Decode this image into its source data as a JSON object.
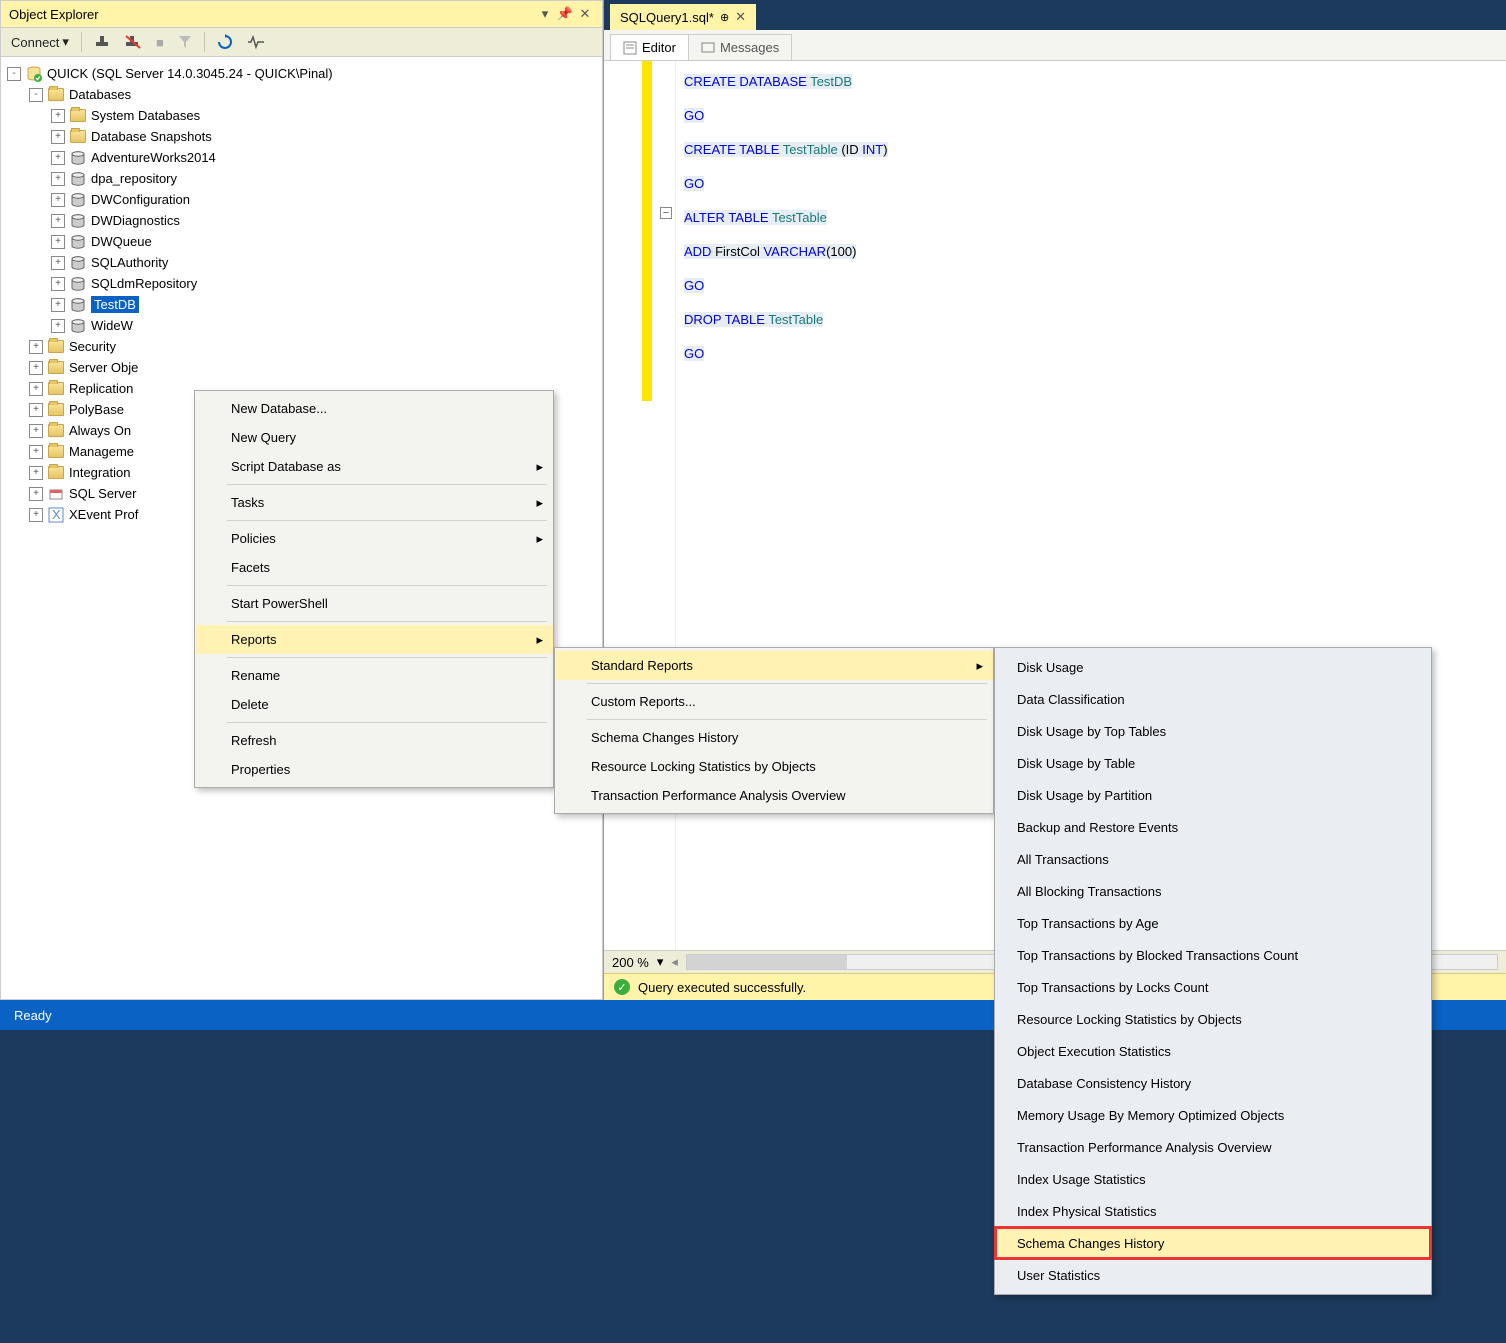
{
  "panel": {
    "title": "Object Explorer"
  },
  "toolbar": {
    "connect": "Connect"
  },
  "tree": {
    "server": "QUICK (SQL Server 14.0.3045.24 - QUICK\\Pinal)",
    "databases": "Databases",
    "dbchildren": [
      "System Databases",
      "Database Snapshots",
      "AdventureWorks2014",
      "dpa_repository",
      "DWConfiguration",
      "DWDiagnostics",
      "DWQueue",
      "SQLAuthority",
      "SQLdmRepository",
      "TestDB",
      "WideW"
    ],
    "after": [
      "Security",
      "Server Obje",
      "Replication",
      "PolyBase",
      "Always On",
      "Manageme",
      "Integration",
      "SQL Server",
      "XEvent Prof"
    ]
  },
  "ctx1": {
    "groups": [
      [
        "New Database...",
        "New Query",
        "Script Database as"
      ],
      [
        "Tasks"
      ],
      [
        "Policies",
        "Facets"
      ],
      [
        "Start PowerShell"
      ],
      [
        "Reports"
      ],
      [
        "Rename",
        "Delete"
      ],
      [
        "Refresh",
        "Properties"
      ]
    ],
    "arrows": [
      "Script Database as",
      "Tasks",
      "Policies",
      "Reports"
    ],
    "highlighted": "Reports"
  },
  "ctx2": {
    "groups": [
      [
        "Standard Reports"
      ],
      [
        "Custom Reports..."
      ],
      [
        "Schema Changes History",
        "Resource Locking Statistics by Objects",
        "Transaction Performance Analysis Overview"
      ]
    ],
    "arrows": [
      "Standard Reports"
    ],
    "highlighted": "Standard Reports"
  },
  "ctx3": {
    "items": [
      "Disk Usage",
      "Data Classification",
      "Disk Usage by Top Tables",
      "Disk Usage by Table",
      "Disk Usage by Partition",
      "Backup and Restore Events",
      "All Transactions",
      "All Blocking Transactions",
      "Top Transactions by Age",
      "Top Transactions by Blocked Transactions Count",
      "Top Transactions by Locks Count",
      "Resource Locking Statistics by Objects",
      "Object Execution Statistics",
      "Database Consistency History",
      "Memory Usage By Memory Optimized Objects",
      "Transaction Performance Analysis Overview",
      "Index Usage Statistics",
      "Index Physical Statistics",
      "Schema Changes History",
      "User Statistics"
    ],
    "highlighted": "Schema Changes History"
  },
  "docTab": "SQLQuery1.sql*",
  "subtabs": {
    "editor": "Editor",
    "messages": "Messages"
  },
  "code": [
    [
      {
        "t": "CREATE ",
        "c": "kw"
      },
      {
        "t": "DATABASE ",
        "c": "kw"
      },
      {
        "t": "TestDB",
        "c": "tk"
      }
    ],
    [
      {
        "t": "GO",
        "c": "kw"
      }
    ],
    [
      {
        "t": "CREATE ",
        "c": "kw"
      },
      {
        "t": "TABLE ",
        "c": "kw"
      },
      {
        "t": "TestTable ",
        "c": "tk"
      },
      {
        "t": "(",
        "c": "plain"
      },
      {
        "t": "ID ",
        "c": "plain"
      },
      {
        "t": "INT",
        "c": "dt"
      },
      {
        "t": ")",
        "c": "plain"
      }
    ],
    [
      {
        "t": "GO",
        "c": "kw"
      }
    ],
    [
      {
        "t": "ALTER ",
        "c": "kw"
      },
      {
        "t": "TABLE ",
        "c": "kw"
      },
      {
        "t": "TestTable",
        "c": "tk"
      }
    ],
    [
      {
        "t": "ADD ",
        "c": "kw"
      },
      {
        "t": "FirstCol ",
        "c": "plain"
      },
      {
        "t": "VARCHAR",
        "c": "dt"
      },
      {
        "t": "(",
        "c": "plain"
      },
      {
        "t": "100",
        "c": "num"
      },
      {
        "t": ")",
        "c": "plain"
      }
    ],
    [
      {
        "t": "GO",
        "c": "kw"
      }
    ],
    [
      {
        "t": "DROP ",
        "c": "kw"
      },
      {
        "t": "TABLE ",
        "c": "kw"
      },
      {
        "t": "TestTable",
        "c": "tk"
      }
    ],
    [
      {
        "t": "GO",
        "c": "kw"
      }
    ]
  ],
  "zoom": "200 %",
  "execStatus": "Query executed successfully.",
  "appStatus": "Ready"
}
